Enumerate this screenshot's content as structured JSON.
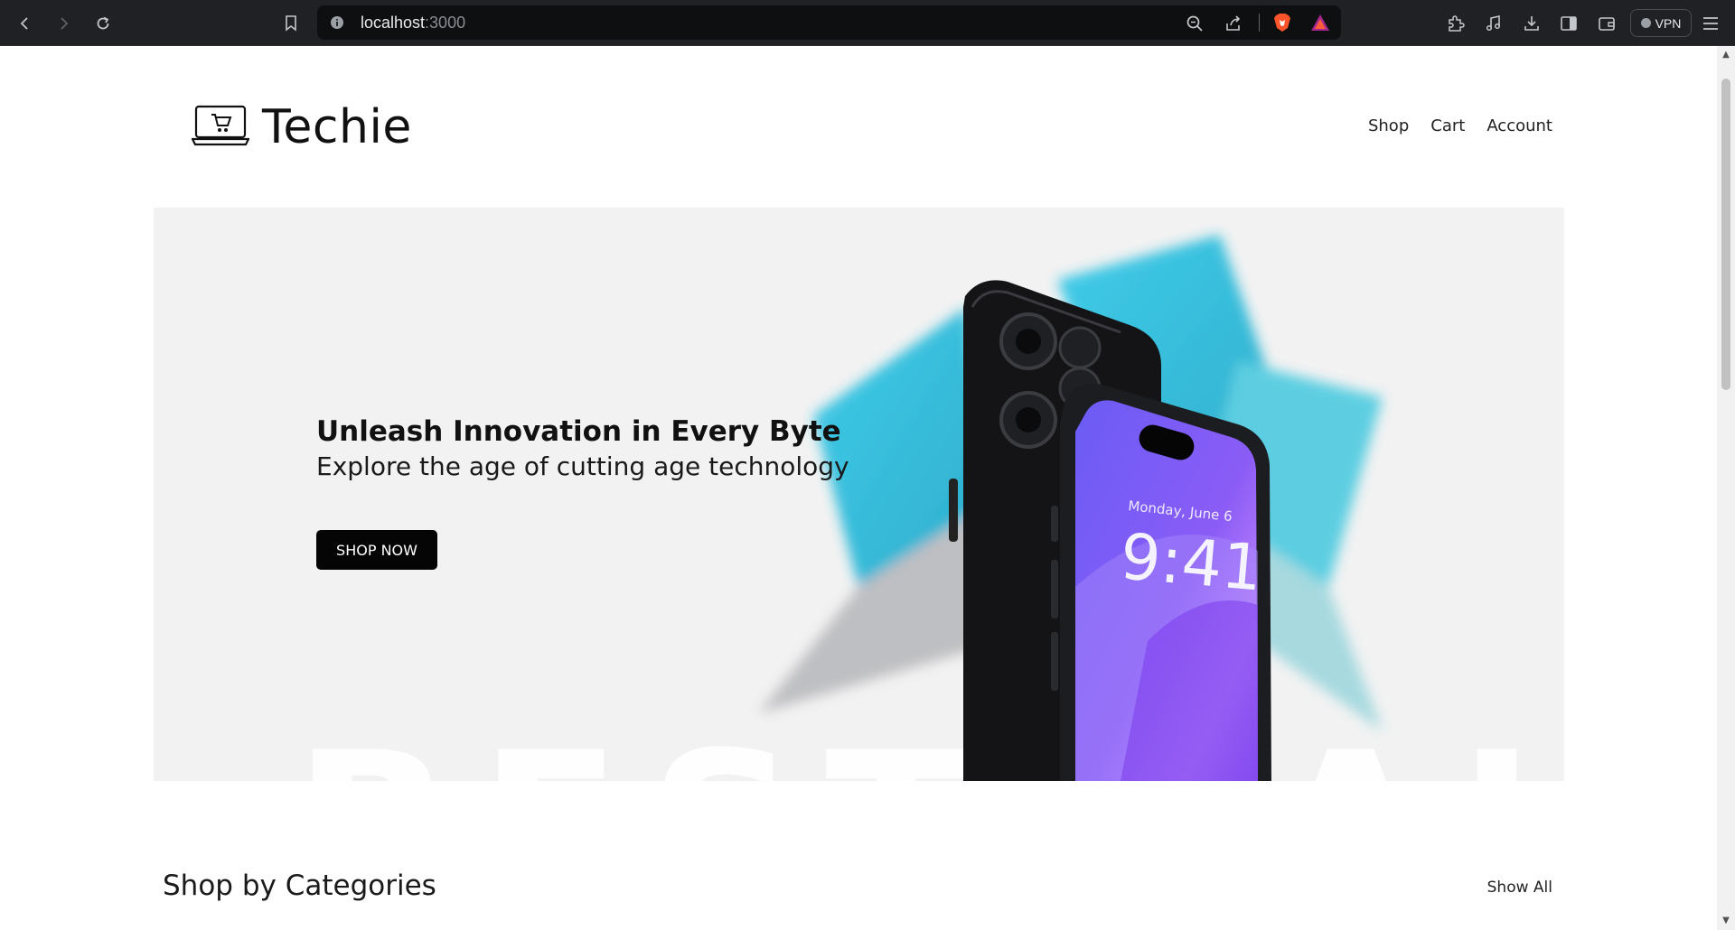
{
  "browser": {
    "url_host": "localhost",
    "url_port": ":3000",
    "vpn_label": "VPN"
  },
  "header": {
    "brand": "Techie",
    "nav": [
      "Shop",
      "Cart",
      "Account"
    ]
  },
  "hero": {
    "title": "Unleash Innovation in Every Byte",
    "subtitle": "Explore the age of cutting age technology",
    "cta": "SHOP NOW",
    "background_text": "BEST SALE",
    "phone_date": "Monday, June 6",
    "phone_time": "9:41"
  },
  "categories": {
    "title": "Shop by Categories",
    "show_all": "Show All"
  },
  "colors": {
    "chrome": "#202124",
    "hero_bg": "#f2f2f2",
    "cta_bg": "#050505",
    "phone_screen": "#7b5cf0"
  },
  "icons": [
    "back-icon",
    "forward-icon",
    "reload-icon",
    "bookmark-icon",
    "info-icon",
    "zoom-icon",
    "share-icon",
    "brave-shield-icon",
    "brave-rewards-icon",
    "extensions-icon",
    "media-icon",
    "download-icon",
    "sidebar-icon",
    "wallet-icon",
    "menu-icon",
    "cart-laptop-logo-icon"
  ]
}
